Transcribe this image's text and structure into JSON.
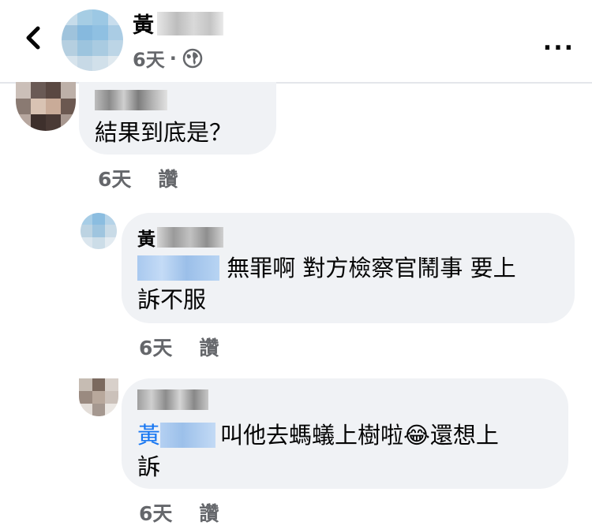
{
  "header": {
    "back_icon": "chevron-left-icon",
    "name_visible": "黃",
    "time": "6天",
    "separator": "·",
    "privacy_icon": "globe-icon",
    "more_label": "..."
  },
  "comments": [
    {
      "author_visible": "",
      "text": "結果到底是？",
      "time": "6天",
      "like_label": "讚"
    },
    {
      "author_visible": "黃",
      "mention_visible": "",
      "text_line1": "無罪啊 對方檢察官鬧事 要上",
      "text_line2": "訴不服",
      "time": "6天",
      "like_label": "讚"
    },
    {
      "author_visible": "",
      "mention_visible": "黃",
      "text_line1_a": "叫他去螞蟻上樹啦",
      "emoji": "😂",
      "text_line1_b": "還想上",
      "text_line2": "訴",
      "time": "6天",
      "like_label": "讚"
    }
  ],
  "colors": {
    "bubble": "#f0f2f5",
    "meta_text": "#65676b",
    "mention": "#1877f2",
    "divider": "#e4e6eb"
  }
}
